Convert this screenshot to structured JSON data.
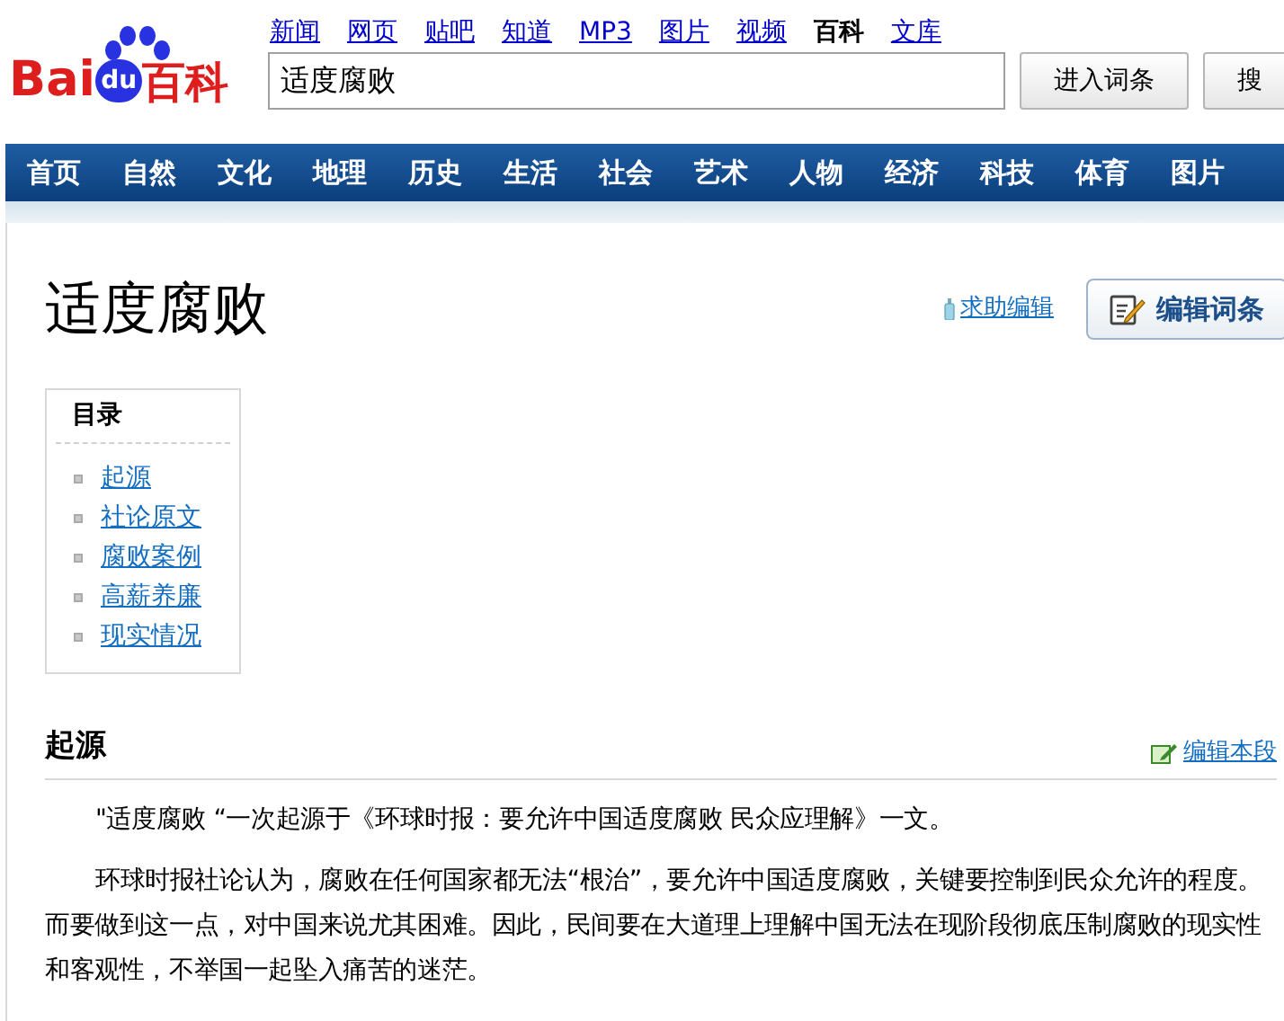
{
  "logo": {
    "part_1": "Bai",
    "part_2": "du",
    "part_3": "百科"
  },
  "top_links": [
    {
      "label": "新闻",
      "selected": false
    },
    {
      "label": "网页",
      "selected": false
    },
    {
      "label": "贴吧",
      "selected": false
    },
    {
      "label": "知道",
      "selected": false
    },
    {
      "label": "MP3",
      "selected": false
    },
    {
      "label": "图片",
      "selected": false
    },
    {
      "label": "视频",
      "selected": false
    },
    {
      "label": "百科",
      "selected": true
    },
    {
      "label": "文库",
      "selected": false
    }
  ],
  "search": {
    "value": "适度腐败",
    "buttons": [
      "进入词条",
      "搜"
    ]
  },
  "nav": [
    "首页",
    "自然",
    "文化",
    "地理",
    "历史",
    "生活",
    "社会",
    "艺术",
    "人物",
    "经济",
    "科技",
    "体育",
    "图片"
  ],
  "article": {
    "title": "适度腐败",
    "help_link": "求助编辑",
    "edit_button": "编辑词条"
  },
  "toc": {
    "title": "目录",
    "items": [
      "起源",
      "社论原文",
      "腐败案例",
      "高薪养廉",
      "现实情况"
    ]
  },
  "section": {
    "heading": "起源",
    "edit_link": "编辑本段",
    "paragraphs": [
      "\"适度腐败 “一次起源于《环球时报：要允许中国适度腐败 民众应理解》一文。",
      "环球时报社论认为，腐败在任何国家都无法“根治”，要允许中国适度腐败，关键要控制到民众允许的程度。而要做到这一点，对中国来说尤其困难。因此，民间要在大道理上理解中国无法在现阶段彻底压制腐败的现实性和客观性，不举国一起坠入痛苦的迷茫。"
    ]
  }
}
